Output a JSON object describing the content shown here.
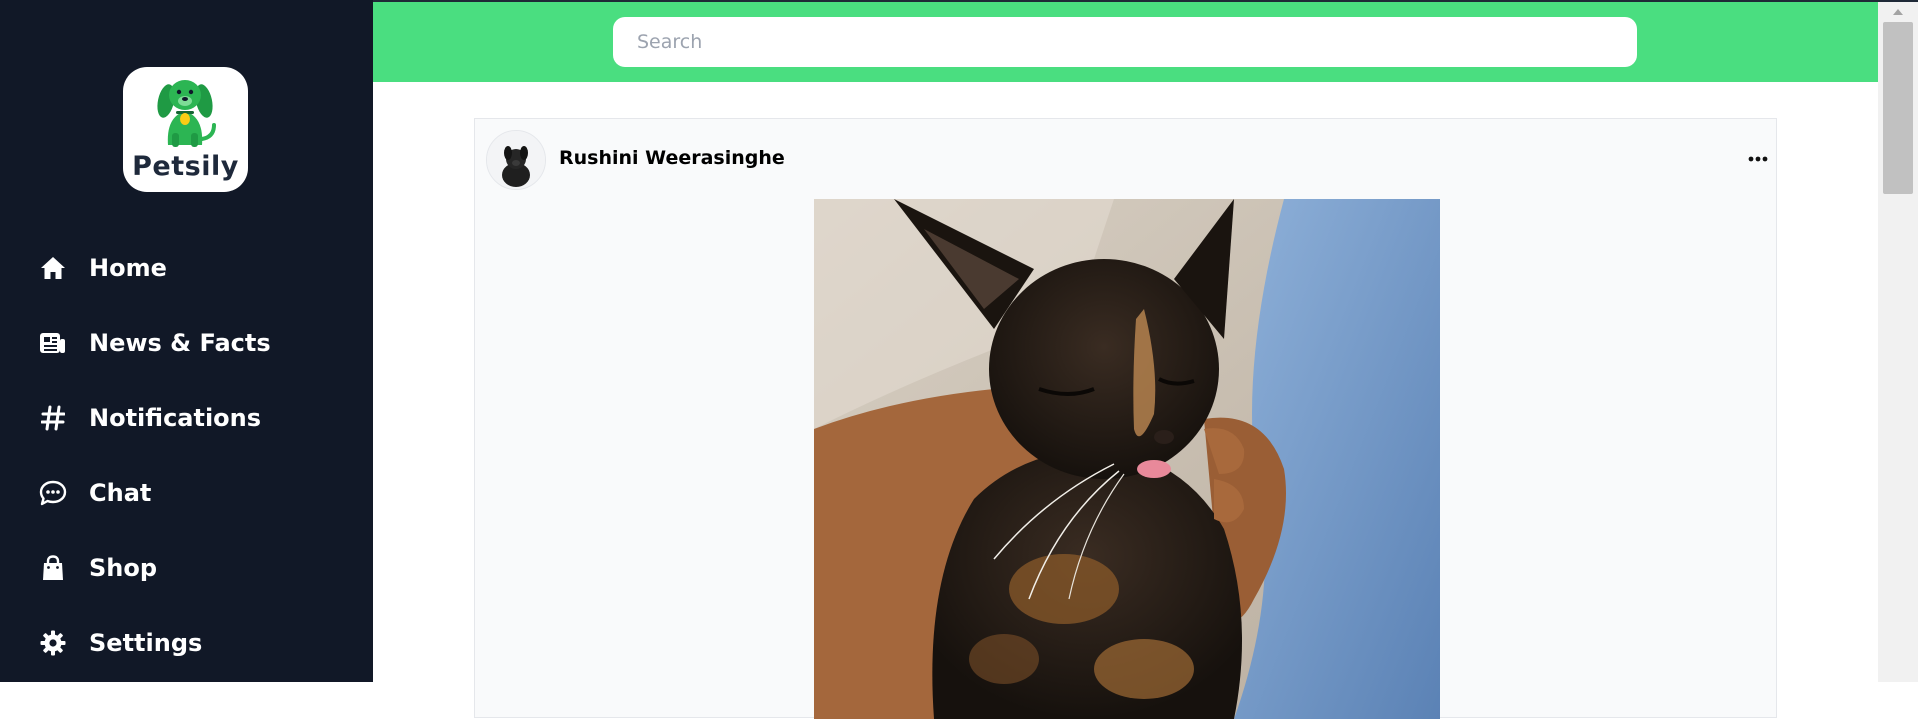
{
  "app": {
    "brand": "Petsily"
  },
  "sidebar": {
    "items": [
      {
        "label": "Home",
        "icon": "home-icon"
      },
      {
        "label": "News & Facts",
        "icon": "newspaper-icon"
      },
      {
        "label": "Notifications",
        "icon": "hashtag-icon"
      },
      {
        "label": "Chat",
        "icon": "chat-bubble-icon"
      },
      {
        "label": "Shop",
        "icon": "shopping-bag-icon"
      },
      {
        "label": "Settings",
        "icon": "gear-icon"
      }
    ]
  },
  "header": {
    "search_placeholder": "Search",
    "search_value": ""
  },
  "post": {
    "author": "Rushini Weerasinghe",
    "avatar_icon": "user-avatar-dog-photo",
    "menu_icon": "more-horizontal-icon",
    "image_subject": "tortoiseshell-cat-photo"
  },
  "colors": {
    "sidebar_bg": "#111827",
    "header_bg": "#4ade80",
    "brand_green": "#22a447",
    "card_bg": "#f9fafb"
  }
}
